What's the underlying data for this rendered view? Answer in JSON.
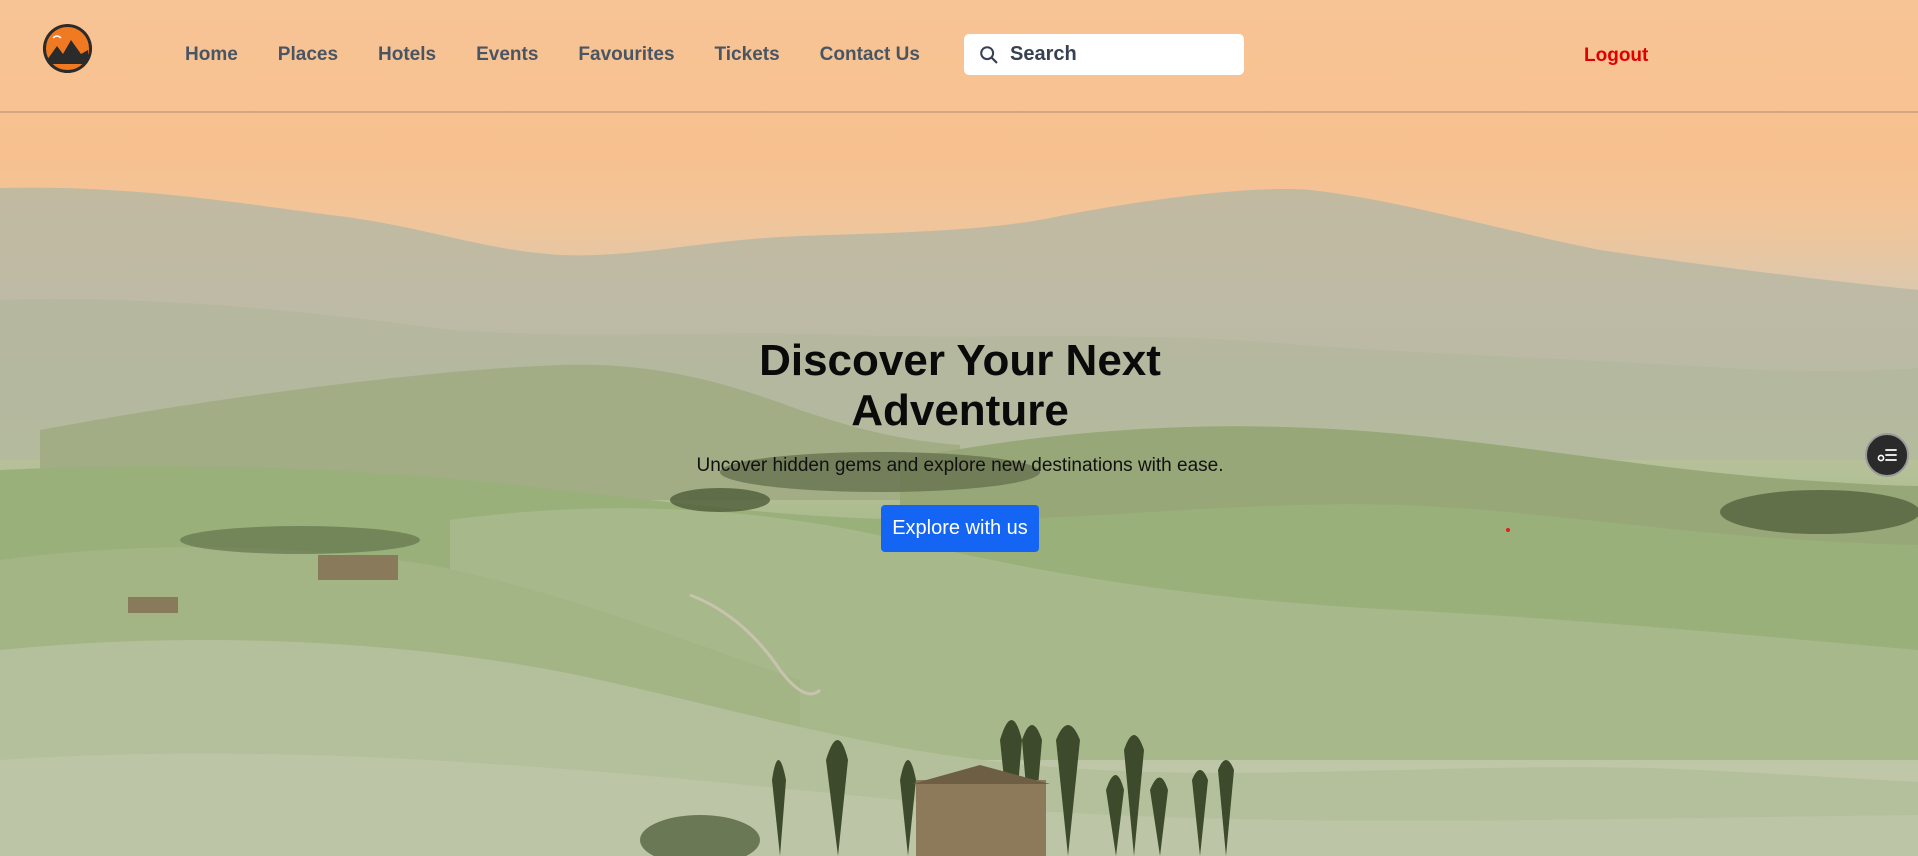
{
  "nav": {
    "logo": "brand-logo",
    "links": [
      "Home",
      "Places",
      "Hotels",
      "Events",
      "Favourites",
      "Tickets",
      "Contact Us"
    ],
    "search_placeholder": "Search",
    "logout_label": "Logout",
    "logout_color": "#e00000"
  },
  "hero": {
    "title": "Discover Your Next Adventure",
    "subtitle": "Uncover hidden gems and explore new destinations with ease.",
    "cta_label": "Explore with us",
    "cta_color": "#1565f5"
  },
  "floating_button": {
    "icon": "menu-list-icon"
  }
}
